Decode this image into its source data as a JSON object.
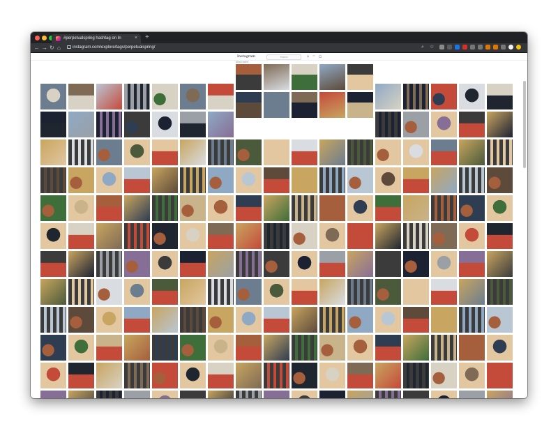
{
  "browser": {
    "tab": {
      "title": "#perpetualspring hashtag on In",
      "close_glyph": "×"
    },
    "new_tab_glyph": "+",
    "nav": {
      "back_glyph": "←",
      "forward_glyph": "→",
      "reload_glyph": "↻",
      "home_glyph": "⌂"
    },
    "url": "instagram.com/explore/tags/perpetualspring/",
    "toolbar_glyphs": {
      "search": "⌕",
      "star": "☆"
    },
    "extension_colors": [
      "#8a8a8a",
      "#5b5b5b",
      "#1a73e8",
      "#d93025",
      "#777777",
      "#777777",
      "#e37400",
      "#e37400",
      "#777777",
      "#f2f2f2",
      "#f4c20d"
    ],
    "traffic_lights": [
      "#ff5f57",
      "#febc2e",
      "#28c840"
    ]
  },
  "instagram": {
    "logo": "Instagram",
    "search_placeholder": "Search",
    "header_icons": "◇ ♡ ◯",
    "section_heading": "Most recent"
  },
  "grid": {
    "rows": 12,
    "cols": 17,
    "palette": [
      "#6b7d8e",
      "#c9b38a",
      "#3b3b3b",
      "#8fa9c4",
      "#d8d2c4",
      "#4a5a3a",
      "#a55f3c",
      "#1d2233",
      "#b9c6d4",
      "#7f6a55",
      "#e2c7a0",
      "#2f3d52",
      "#9aa0a6",
      "#5e4a3a",
      "#c44a3a",
      "#d9dde2",
      "#3e6e3a",
      "#876e96",
      "#c8a560",
      "#20262f"
    ]
  }
}
